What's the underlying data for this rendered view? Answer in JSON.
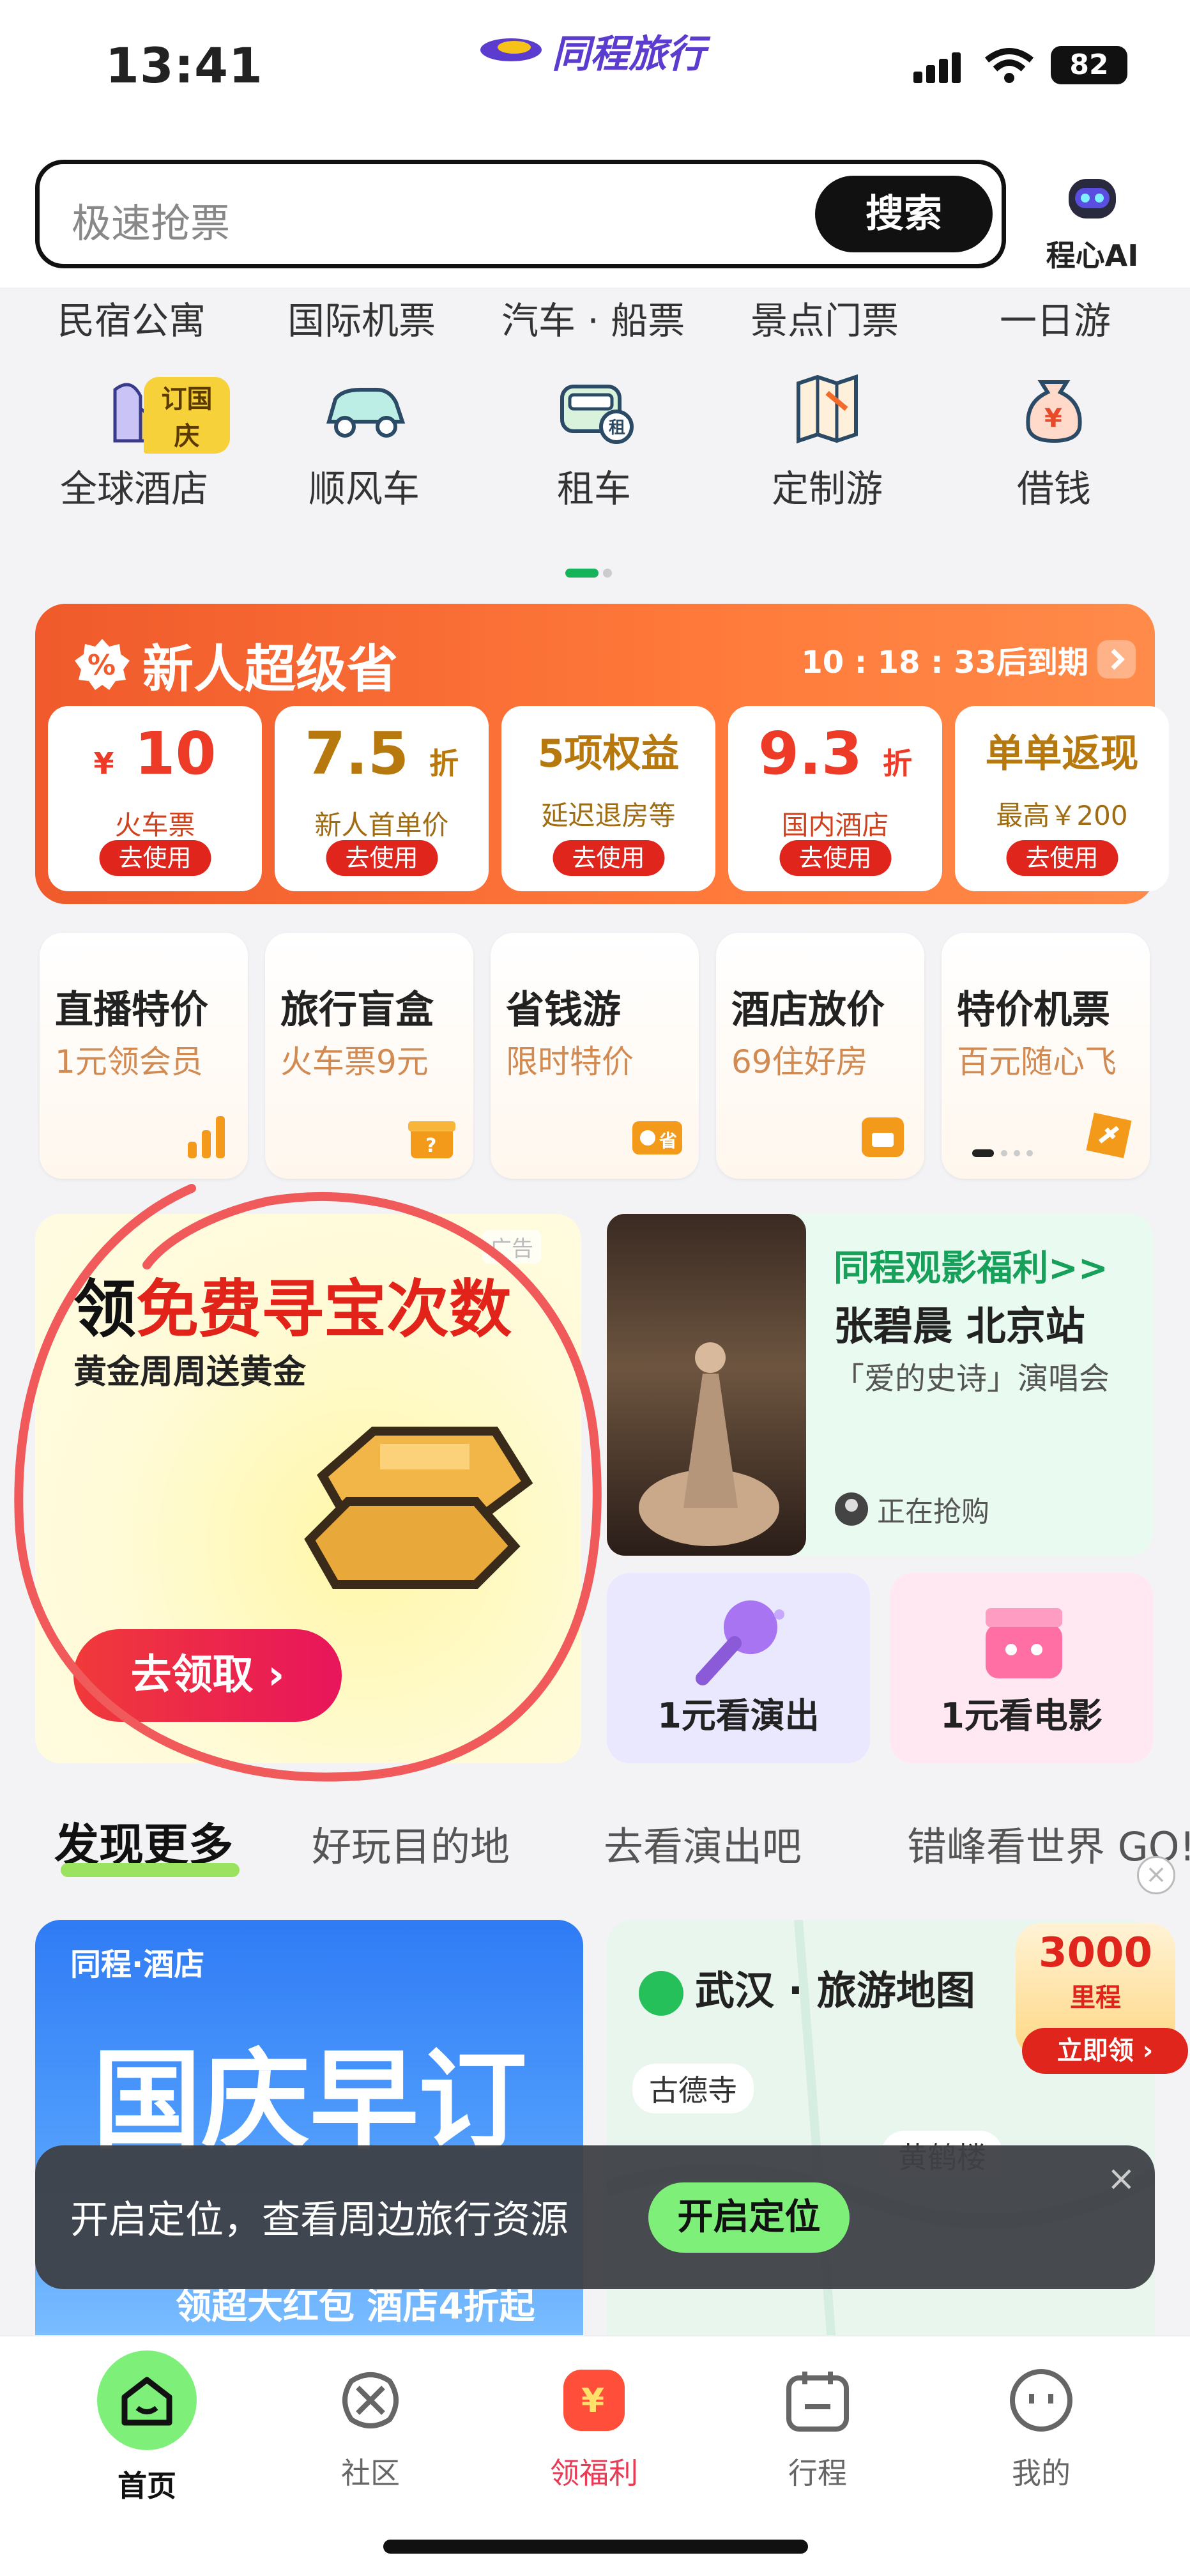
{
  "status_bar": {
    "time": "13:41",
    "brand": "同程旅行",
    "battery": "82"
  },
  "search": {
    "placeholder": "极速抢票",
    "button": "搜索"
  },
  "ai": {
    "label": "程心AI"
  },
  "top_nav": [
    "民宿公寓",
    "国际机票",
    "汽车 · 船票",
    "景点门票",
    "一日游"
  ],
  "icon_nav": [
    {
      "label": "全球酒店",
      "badge": "订国庆",
      "icon": "hotel-icon"
    },
    {
      "label": "顺风车",
      "icon": "car-icon"
    },
    {
      "label": "租车",
      "icon": "rental-car-icon"
    },
    {
      "label": "定制游",
      "icon": "custom-tour-icon"
    },
    {
      "label": "借钱",
      "icon": "money-bag-icon"
    }
  ],
  "promo": {
    "title": "新人超级省",
    "timer": "10 : 18 : 33后到期",
    "coupons": [
      {
        "big": "10",
        "prefix": "¥",
        "unit": "",
        "sub": "火车票",
        "btn": "去使用"
      },
      {
        "big": "7.5",
        "prefix": "",
        "unit": "折",
        "sub": "新人首单价",
        "btn": "去使用"
      },
      {
        "big": "5项权益",
        "prefix": "",
        "unit": "",
        "sub": "延迟退房等",
        "btn": "去使用"
      },
      {
        "big": "9.3",
        "prefix": "",
        "unit": "折",
        "sub": "国内酒店",
        "btn": "去使用"
      },
      {
        "big": "单单返现",
        "prefix": "",
        "unit": "",
        "sub": "最高￥200",
        "btn": "去使用"
      }
    ]
  },
  "features": [
    {
      "title": "直播特价",
      "sub": "1元领会员"
    },
    {
      "title": "旅行盲盒",
      "sub": "火车票9元"
    },
    {
      "title": "省钱游",
      "sub": "限时特价"
    },
    {
      "title": "酒店放价",
      "sub": "69住好房"
    },
    {
      "title": "特价机票",
      "sub": "百元随心飞"
    }
  ],
  "treasure": {
    "title_prefix": "领",
    "title_main": "免费寻宝次数",
    "subtitle": "黄金周周送黄金",
    "button": "去领取 ›",
    "ad": "广告"
  },
  "concert": {
    "title": "同程观影福利>>",
    "artist": "张碧晨 北京站",
    "show": "「爱的史诗」演唱会",
    "status": "正在抢购"
  },
  "mini_cards": [
    {
      "label": "1元看演出"
    },
    {
      "label": "1元看电影"
    }
  ],
  "discover_tabs": [
    "发现更多",
    "好玩目的地",
    "去看演出吧",
    "错峰看世界 GO!"
  ],
  "card_hotel": {
    "logo": "同程·酒店",
    "headline": "国庆早订",
    "small": "领超大红包 酒店4折起"
  },
  "card_map": {
    "title": "武汉 · 旅游地图",
    "pins": [
      "古德寺",
      "黄鹤楼"
    ],
    "badge_num": "3000",
    "badge_unit": "里程",
    "badge_btn": "立即领 ›"
  },
  "toast": {
    "text": "开启定位，查看周边旅行资源",
    "button": "开启定位",
    "close": "×"
  },
  "tabbar": [
    {
      "label": "首页",
      "icon": "home-icon"
    },
    {
      "label": "社区",
      "icon": "community-icon"
    },
    {
      "label": "领福利",
      "icon": "welfare-icon"
    },
    {
      "label": "行程",
      "icon": "itinerary-icon"
    },
    {
      "label": "我的",
      "icon": "profile-icon"
    }
  ],
  "colors": {
    "accent": "#e0251d",
    "brand": "#5b3ccf",
    "green": "#16a05a"
  }
}
